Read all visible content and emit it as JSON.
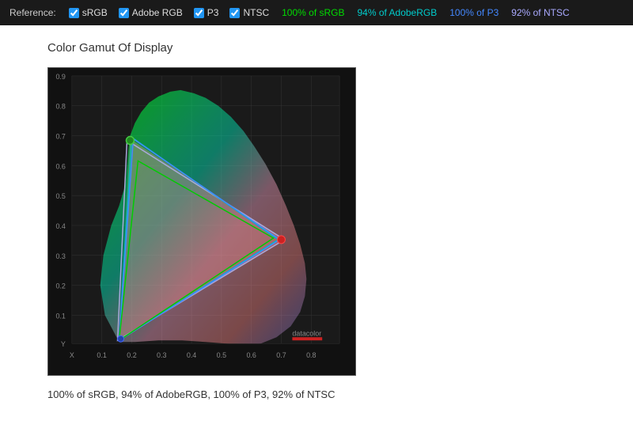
{
  "reference_bar": {
    "label": "Reference:",
    "items": [
      {
        "id": "srgb",
        "name": "sRGB",
        "checked": true,
        "color": "#2196F3"
      },
      {
        "id": "adobe",
        "name": "Adobe RGB",
        "checked": true,
        "color": "#2196F3"
      },
      {
        "id": "p3",
        "name": "P3",
        "checked": true,
        "color": "#2196F3"
      },
      {
        "id": "ntsc",
        "name": "NTSC",
        "checked": true,
        "color": "#2196F3"
      }
    ],
    "stats": [
      {
        "id": "srgb-stat",
        "text": "100% of sRGB",
        "class": "stat-srgb"
      },
      {
        "id": "adobe-stat",
        "text": "94% of AdobeRGB",
        "class": "stat-adobe"
      },
      {
        "id": "p3-stat",
        "text": "100% of P3",
        "class": "stat-p3"
      },
      {
        "id": "ntsc-stat",
        "text": "92% of NTSC",
        "class": "stat-ntsc"
      }
    ]
  },
  "chart": {
    "title": "Color Gamut Of Display"
  },
  "summary": {
    "text": "100% of sRGB, 94% of AdobeRGB, 100% of P3, 92% of NTSC"
  },
  "datacolor_label": "datacolor"
}
